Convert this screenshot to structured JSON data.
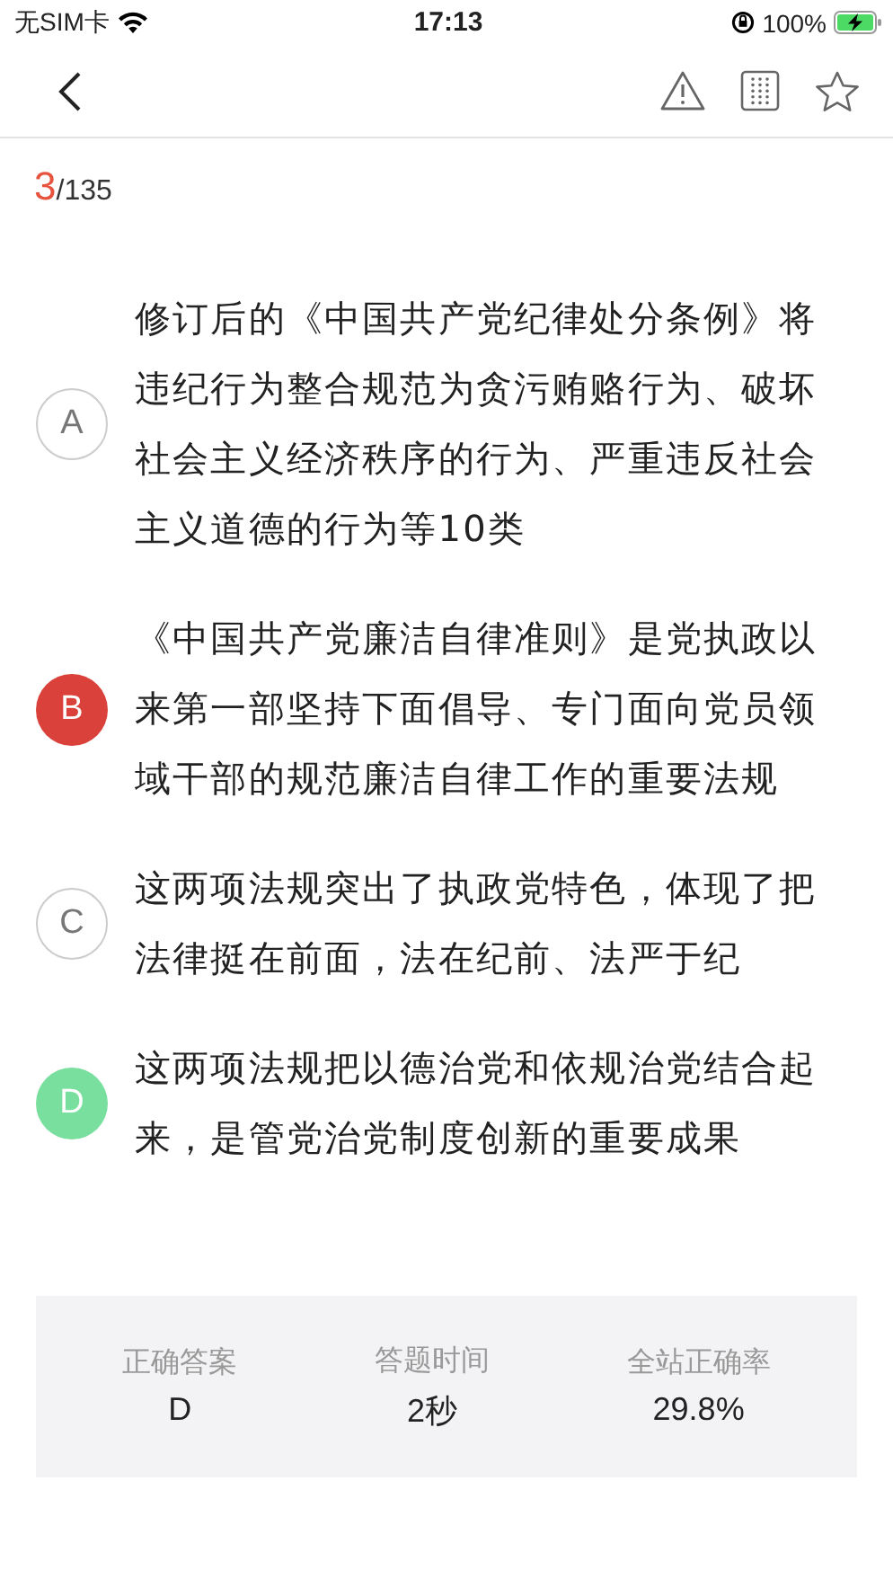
{
  "status_bar": {
    "carrier": "无SIM卡",
    "time": "17:13",
    "battery": "100%"
  },
  "progress": {
    "current": "3",
    "total": "/135"
  },
  "options": [
    {
      "letter": "A",
      "selected": false,
      "correct": false,
      "text": "修订后的《中国共产党纪律处分条例》将违纪行为整合规范为贪污贿赂行为、破坏社会主义经济秩序的行为、严重违反社会主义道德的行为等10类"
    },
    {
      "letter": "B",
      "selected": true,
      "correct": false,
      "text": "《中国共产党廉洁自律准则》是党执政以来第一部坚持下面倡导、专门面向党员领域干部的规范廉洁自律工作的重要法规"
    },
    {
      "letter": "C",
      "selected": false,
      "correct": false,
      "text": "这两项法规突出了执政党特色，体现了把法律挺在前面，法在纪前、法严于纪"
    },
    {
      "letter": "D",
      "selected": false,
      "correct": true,
      "text": "这两项法规把以德治党和依规治党结合起来，是管党治党制度创新的重要成果"
    }
  ],
  "stats": [
    {
      "label": "正确答案",
      "value": "D"
    },
    {
      "label": "答题时间",
      "value": "2秒"
    },
    {
      "label": "全站正确率",
      "value": "29.8%"
    }
  ]
}
